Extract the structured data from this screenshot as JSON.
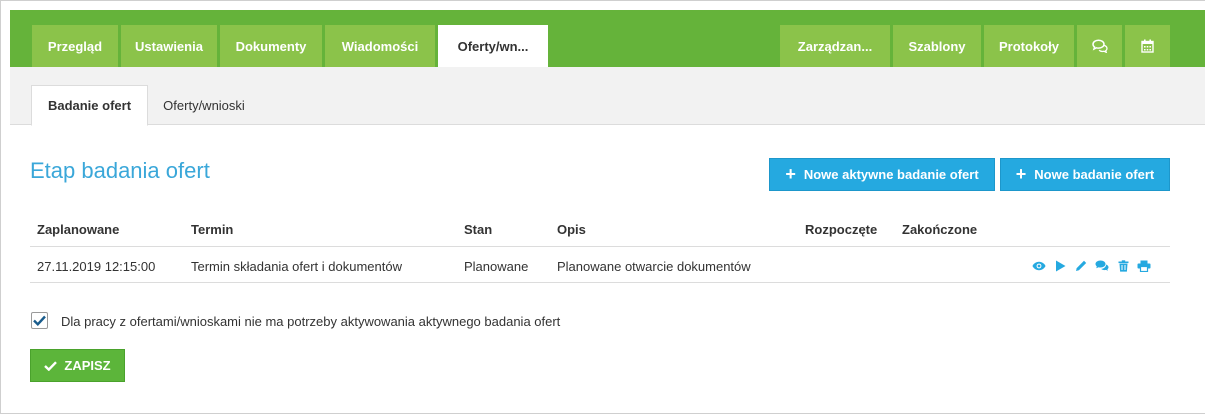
{
  "main_tabs": {
    "przeglad": "Przegląd",
    "ustawienia": "Ustawienia",
    "dokumenty": "Dokumenty",
    "wiadomosci": "Wiadomości",
    "oferty": "Oferty/wn...",
    "zarzadzanie": "Zarządzan...",
    "szablony": "Szablony",
    "protokoly": "Protokoły",
    "chat_icon": "comments-icon",
    "calendar_icon": "calendar-icon"
  },
  "sub_tabs": {
    "badanie": "Badanie ofert",
    "oferty_wnioski": "Oferty/wnioski"
  },
  "page_title": "Etap badania ofert",
  "buttons": {
    "new_active": "Nowe aktywne badanie ofert",
    "new": "Nowe badanie ofert",
    "save": "ZAPISZ"
  },
  "table": {
    "headers": {
      "zaplanowane": "Zaplanowane",
      "termin": "Termin",
      "stan": "Stan",
      "opis": "Opis",
      "rozpoczete": "Rozpoczęte",
      "zakonczone": "Zakończone"
    },
    "rows": [
      {
        "zaplanowane": "27.11.2019 12:15:00",
        "termin": "Termin składania ofert i dokumentów",
        "stan": "Planowane",
        "opis": "Planowane otwarcie dokumentów",
        "rozpoczete": "",
        "zakonczone": "",
        "actions": [
          "eye-icon",
          "play-icon",
          "pencil-icon",
          "comments-icon",
          "trash-icon",
          "print-icon"
        ]
      }
    ]
  },
  "checkbox": {
    "checked": true,
    "label": "Dla pracy z ofertami/wnioskami nie ma potrzeby aktywowania aktywnego badania ofert"
  },
  "colors": {
    "green_bar": "#65b33a",
    "tab_green": "#8bc34a",
    "accent_blue": "#25a9e0",
    "title_blue": "#3aa7d9",
    "save_green": "#5cb53a"
  }
}
